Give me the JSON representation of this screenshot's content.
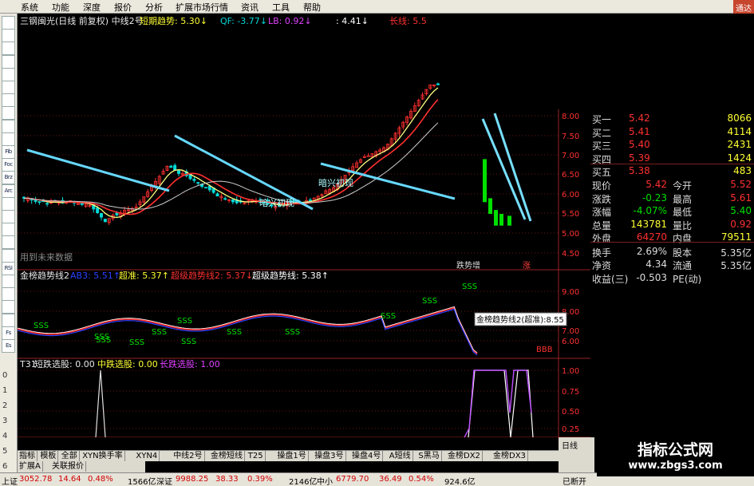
{
  "menu": [
    "系统",
    "功能",
    "深度",
    "报价",
    "分析",
    "扩展市场行情",
    "资讯",
    "工具",
    "帮助"
  ],
  "corner": "通达",
  "toolbar_labels": [
    "",
    "",
    "",
    "",
    "",
    "",
    "",
    "",
    "",
    "",
    "Fib",
    "Foc",
    "Brz",
    "Arc",
    "",
    "",
    "",
    "",
    "",
    "RSI",
    "",
    "",
    "",
    "",
    "Fs",
    "Es"
  ],
  "toolbar_nums": [
    "0",
    "1",
    "2",
    "3",
    "4",
    "5",
    "6"
  ],
  "main": {
    "title": "三钢闽光(日线 前复权) 中线2号",
    "ind1": "短期趋势: 5.30↓",
    "ind2": "QF: -3.77↓",
    "ind3": "LB: 0.92↓",
    "ind4": ": 4.41↓",
    "ind5": "长线: 5.5",
    "notice": "用到未来数据",
    "ann1": "暗兴初现",
    "ann2": "暗兴初现",
    "ann3": "跌势增",
    "ann4": "涨",
    "yticks": [
      "8.00",
      "7.50",
      "7.00",
      "6.50",
      "6.00",
      "5.50",
      "5.00",
      "4.50"
    ]
  },
  "sub1": {
    "l0": "金榜趋势线2",
    "l1": "AB3: 5.51↑",
    "l2": "超准: 5.37↑",
    "l3": "超级趋势线2: 5.37↓",
    "l4": "超级趋势线: 5.38↑",
    "tooltip": "金榜趋势线2(超准):8.55",
    "sss": "SSS",
    "bbb": "BBB",
    "yticks": [
      "9.00",
      "8.00",
      "7.00",
      "6.00"
    ]
  },
  "sub2": {
    "l0": "T31",
    "l1": "短跌选股: 0.00",
    "l2": "中跌选股: 0.00",
    "l3": "长跌选股: 1.00",
    "yticks": [
      "1.00",
      "0.75",
      "0.50",
      "0.25"
    ]
  },
  "time_axis": [
    "2014年",
    "11",
    "12",
    "2",
    "3",
    "4"
  ],
  "tabs": [
    "指标",
    "模板",
    "全部",
    "XYN换手率",
    "XYN4",
    "中线2号",
    "金榜短线",
    "T25",
    "操盘1号",
    "操盘3号",
    "操盘4号",
    "A短线",
    "S黑马",
    "金榜DX2",
    "金榜DX3"
  ],
  "tabs2": [
    "扩展A",
    "关联报价"
  ],
  "rbot": [
    "日线"
  ],
  "quote": {
    "rows": [
      [
        "买一",
        "5.42",
        "8066"
      ],
      [
        "买二",
        "5.41",
        "4114"
      ],
      [
        "买三",
        "5.40",
        "2431"
      ],
      [
        "买四",
        "5.39",
        "1424"
      ],
      [
        "买五",
        "5.38",
        "483"
      ]
    ],
    "stats": [
      [
        "现价",
        "5.42",
        "今开",
        "5.52"
      ],
      [
        "涨跌",
        "-0.23",
        "最高",
        "5.61"
      ],
      [
        "涨幅",
        "-4.07%",
        "最低",
        "5.40"
      ],
      [
        "总量",
        "143781",
        "量比",
        "0.92"
      ],
      [
        "外盘",
        "64270",
        "内盘",
        "79511"
      ],
      [
        "换手",
        "2.69%",
        "股本",
        "5.35亿"
      ],
      [
        "净资",
        "4.34",
        "流通",
        "5.35亿"
      ],
      [
        "收益(三)",
        "-0.503",
        "PE(动)",
        ""
      ]
    ]
  },
  "status": {
    "s1": "上证",
    "s1v": "3052.78",
    "s1c": "14.64",
    "s1p": "0.48%",
    "s1a": "1566亿",
    "s2": "深证",
    "s2v": "9988.25",
    "s2c": "38.33",
    "s2p": "0.39%",
    "s2a": "2146亿",
    "s3": "中小",
    "s3v": "6779.70",
    "s3c": "36.49",
    "s3p": "0.54%",
    "s3a": "924.6亿",
    "tail": "已断开"
  },
  "watermark": {
    "a": "指标公式网",
    "b": "www.zbgs3.com"
  },
  "colors": {
    "up": "#ff3030",
    "down": "#00d8d8",
    "flat": "#e0e0e0",
    "green": "#00e000",
    "yellow": "#ffff33",
    "label": "#e8e8e8"
  }
}
